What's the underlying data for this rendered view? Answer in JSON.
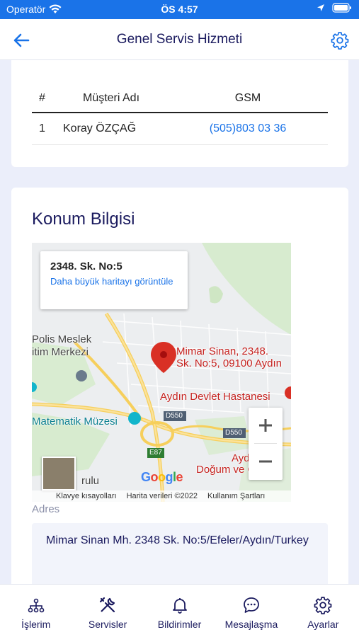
{
  "status_bar": {
    "carrier": "Operatör",
    "time": "ÖS 4:57"
  },
  "nav": {
    "title": "Genel Servis Hizmeti"
  },
  "customers_table": {
    "headers": [
      "#",
      "Müşteri Adı",
      "GSM"
    ],
    "rows": [
      {
        "no": "1",
        "name": "Koray ÖZÇAĞ",
        "gsm": "(505)803 03 36"
      }
    ]
  },
  "location": {
    "title": "Konum Bilgisi",
    "map": {
      "info_address": "2348. Sk. No:5",
      "info_link": "Daha büyük haritayı görüntüle",
      "pin_label_1": "Mimar Sinan, 2348.",
      "pin_label_2": "Sk. No:5, 09100 Aydın",
      "place_1a": "Polis Meslek",
      "place_1b": "itim Merkezi",
      "place_2": "Matematik Müzesi",
      "place_3": "Aydın Devlet Hastanesi",
      "place_4a": "Aydı",
      "place_4b": "Doğum ve Çocuk",
      "road_1": "D550",
      "road_2": "D550",
      "road_3": "E87",
      "place_5": "rulu",
      "google": "Google",
      "footer_keyboard": "Klavye kısayolları",
      "footer_data": "Harita verileri ©2022",
      "footer_terms": "Kullanım Şartları"
    },
    "address_label": "Adres",
    "address_value": "Mimar Sinan Mh. 2348 Sk. No:5/Efeler/Aydın/Turkey"
  },
  "tabbar": {
    "items": [
      {
        "label": "İşlerim",
        "icon": "sitemap-icon"
      },
      {
        "label": "Servisler",
        "icon": "tools-icon"
      },
      {
        "label": "Bildirimler",
        "icon": "bell-icon"
      },
      {
        "label": "Mesajlaşma",
        "icon": "chat-icon"
      },
      {
        "label": "Ayarlar",
        "icon": "gear-icon"
      }
    ]
  }
}
